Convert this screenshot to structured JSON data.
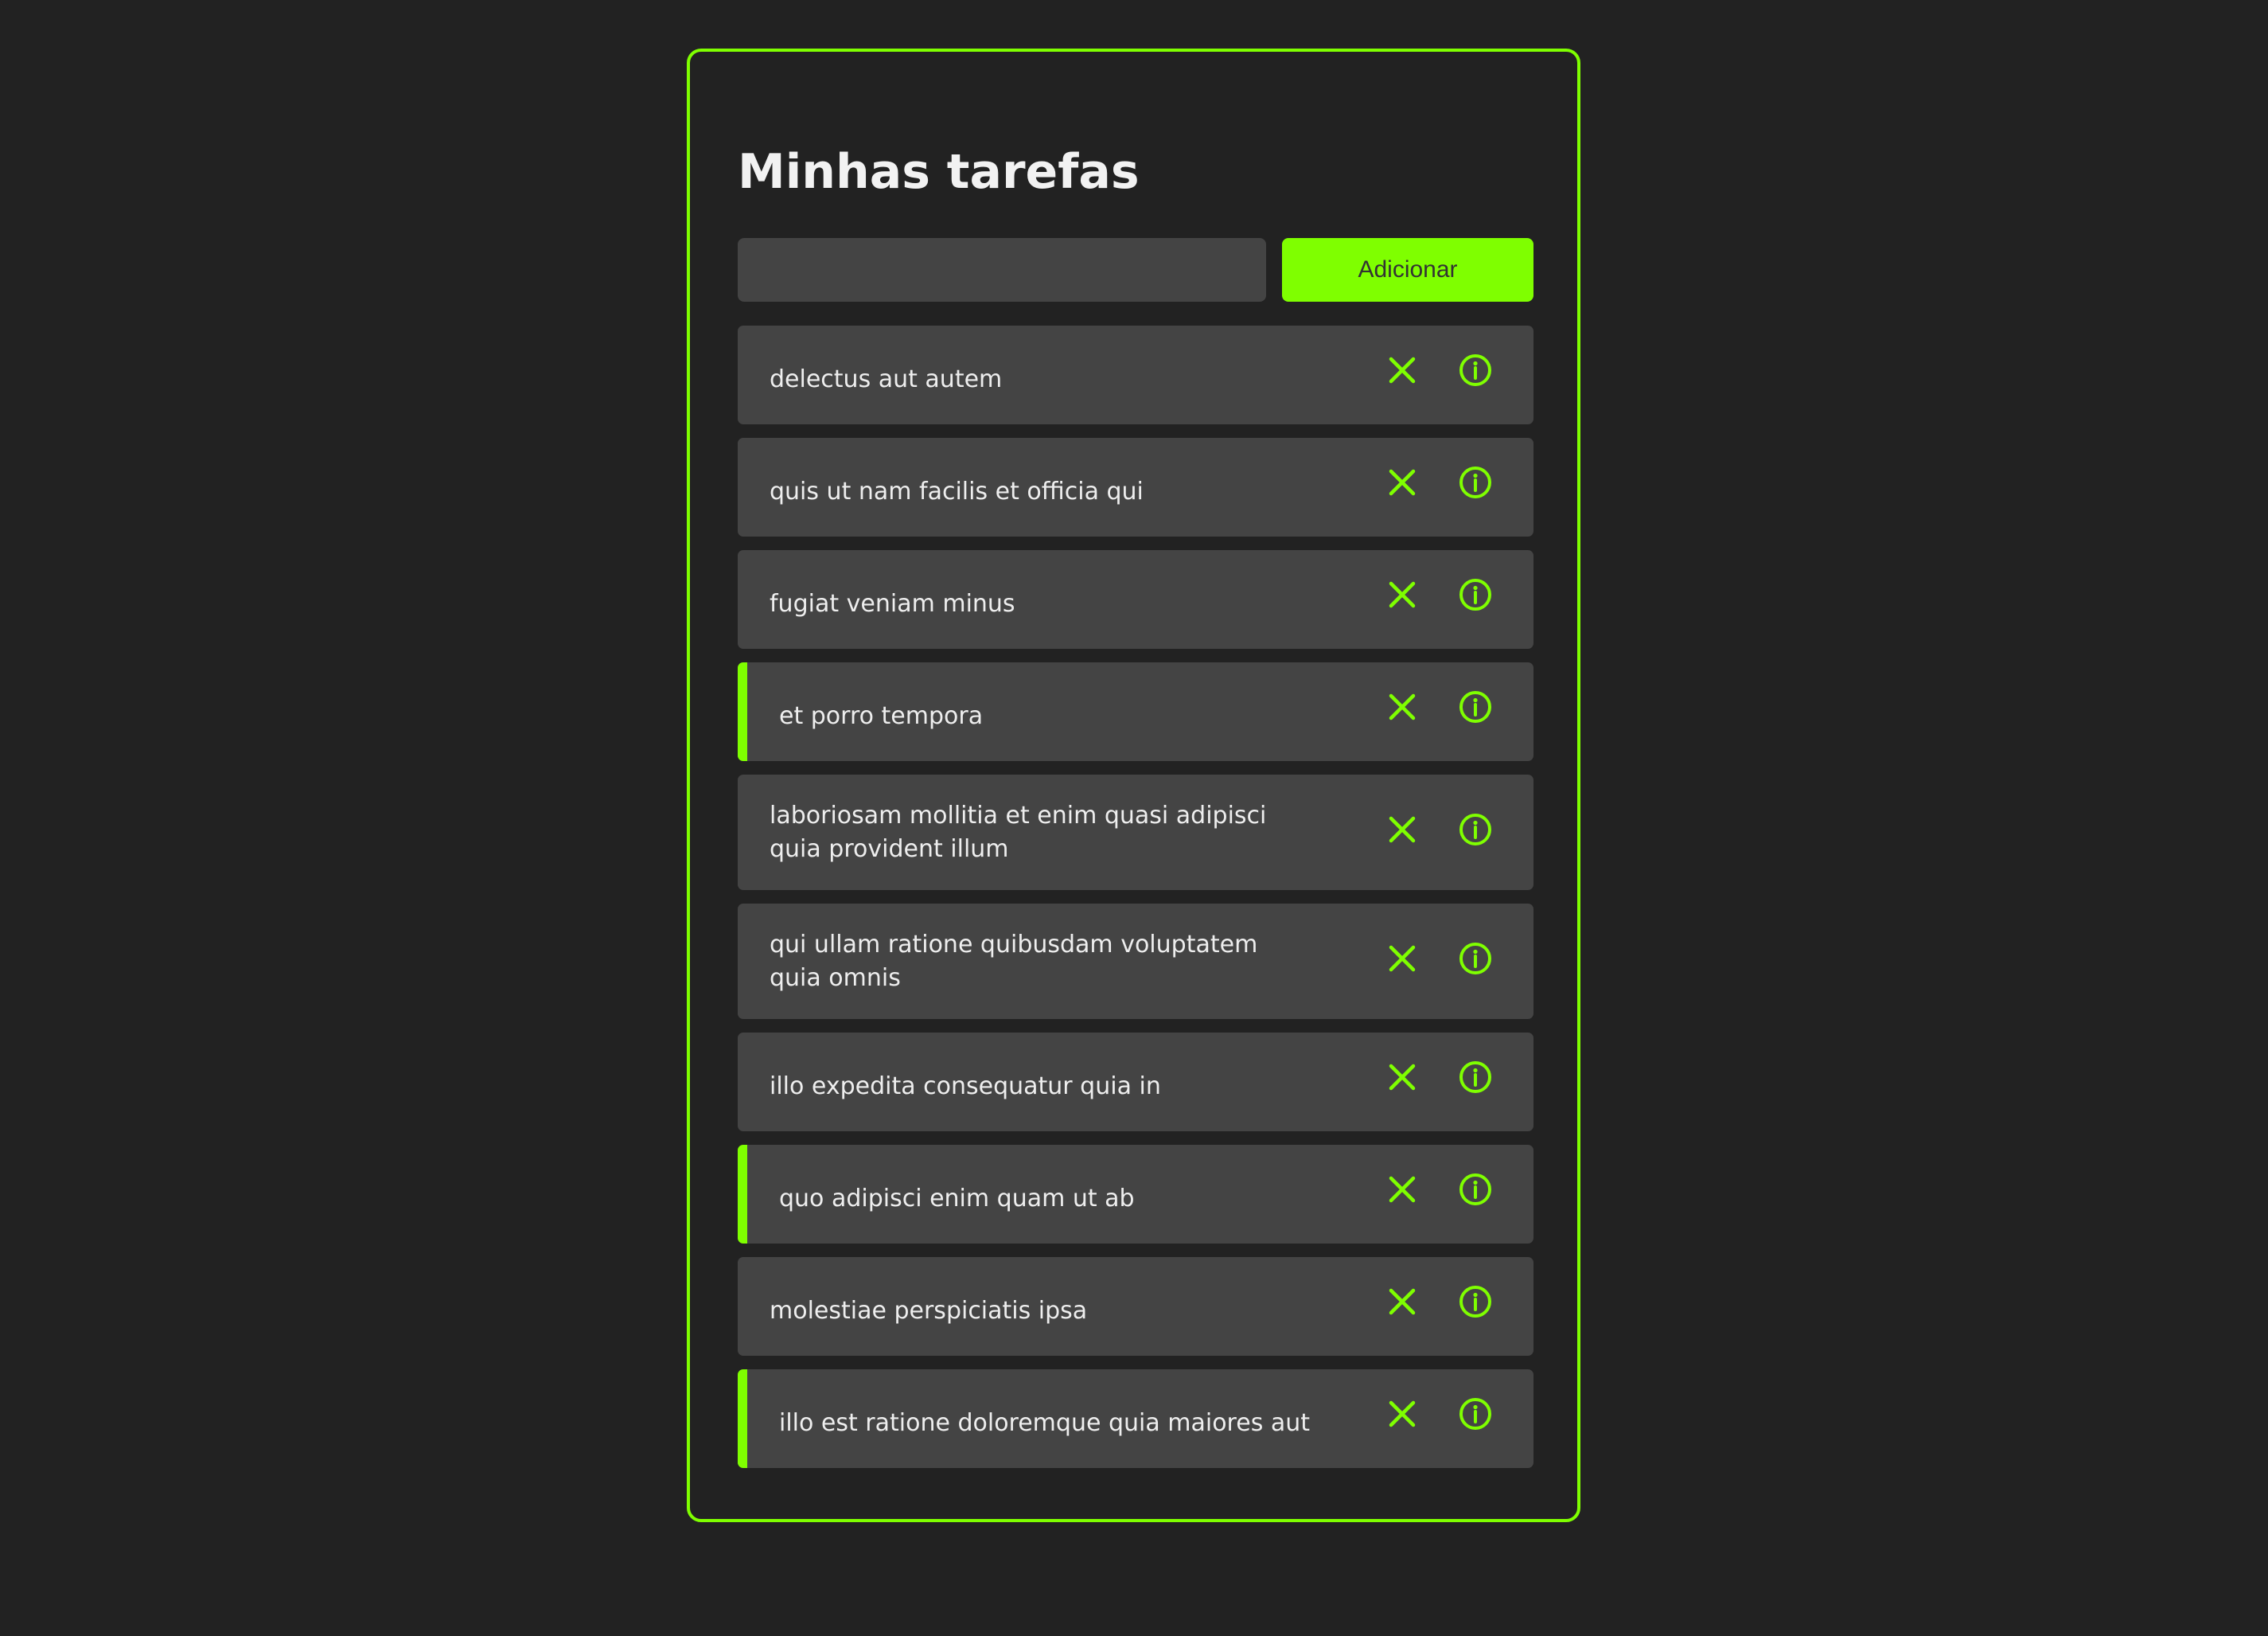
{
  "header": {
    "title": "Minhas tarefas"
  },
  "form": {
    "input_value": "",
    "input_placeholder": "",
    "add_label": "Adicionar"
  },
  "colors": {
    "accent": "#7fff00",
    "background": "#222222",
    "surface": "#444444",
    "text": "#eeeeee"
  },
  "icons": {
    "remove": "close-icon",
    "details": "info-icon"
  },
  "tasks": [
    {
      "title": "delectus aut autem",
      "completed": false
    },
    {
      "title": "quis ut nam facilis et officia qui",
      "completed": false
    },
    {
      "title": "fugiat veniam minus",
      "completed": false
    },
    {
      "title": "et porro tempora",
      "completed": true
    },
    {
      "title": "laboriosam mollitia et enim quasi adipisci quia provident illum",
      "completed": false
    },
    {
      "title": "qui ullam ratione quibusdam voluptatem quia omnis",
      "completed": false
    },
    {
      "title": "illo expedita consequatur quia in",
      "completed": false
    },
    {
      "title": "quo adipisci enim quam ut ab",
      "completed": true
    },
    {
      "title": "molestiae perspiciatis ipsa",
      "completed": false
    },
    {
      "title": "illo est ratione doloremque quia maiores aut",
      "completed": true
    }
  ]
}
